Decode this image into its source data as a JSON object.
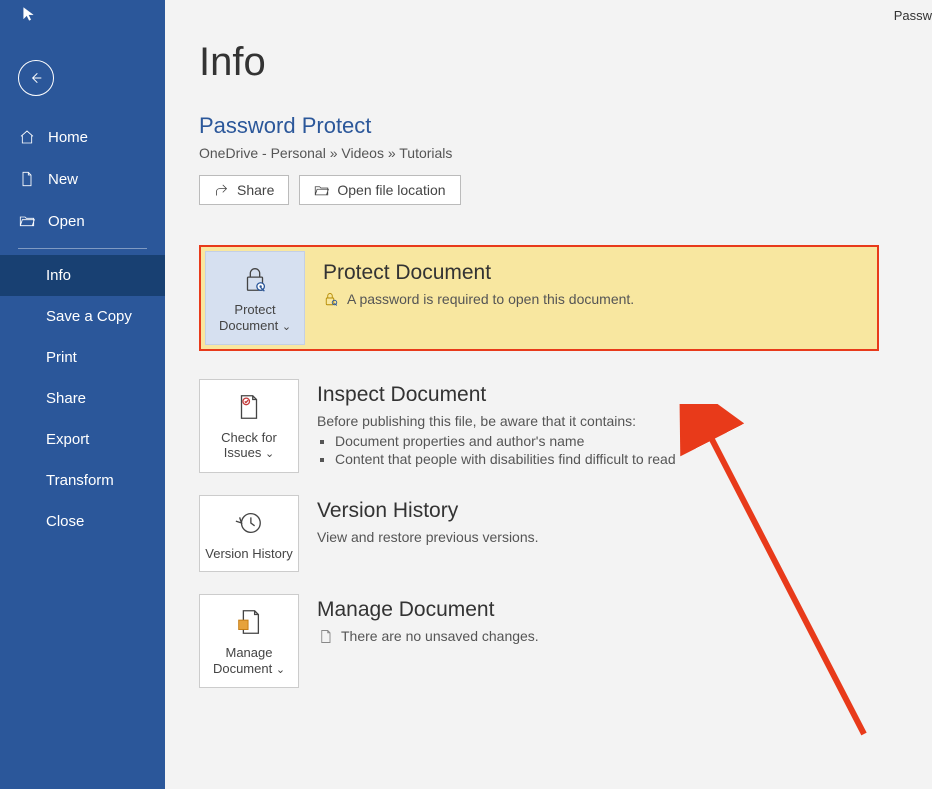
{
  "topRightText": "Passw",
  "sidebar": {
    "back": "Back",
    "primary": [
      {
        "label": "Home",
        "icon": "home-icon"
      },
      {
        "label": "New",
        "icon": "document-icon"
      },
      {
        "label": "Open",
        "icon": "folder-open-icon"
      }
    ],
    "secondary": [
      {
        "label": "Info",
        "selected": true
      },
      {
        "label": "Save a Copy"
      },
      {
        "label": "Print"
      },
      {
        "label": "Share"
      },
      {
        "label": "Export"
      },
      {
        "label": "Transform"
      },
      {
        "label": "Close"
      }
    ]
  },
  "page": {
    "title": "Info",
    "docTitle": "Password Protect",
    "breadcrumb": "OneDrive - Personal » Videos » Tutorials",
    "actions": {
      "share": "Share",
      "openLocation": "Open file location"
    }
  },
  "protect": {
    "tileLabel": "Protect Document",
    "heading": "Protect Document",
    "desc": "A password is required to open this document."
  },
  "inspect": {
    "tileLabel": "Check for Issues",
    "heading": "Inspect Document",
    "intro": "Before publishing this file, be aware that it contains:",
    "items": [
      "Document properties and author's name",
      "Content that people with disabilities find difficult to read"
    ]
  },
  "version": {
    "tileLabel": "Version History",
    "heading": "Version History",
    "desc": "View and restore previous versions."
  },
  "manage": {
    "tileLabel": "Manage Document",
    "heading": "Manage Document",
    "desc": "There are no unsaved changes."
  }
}
